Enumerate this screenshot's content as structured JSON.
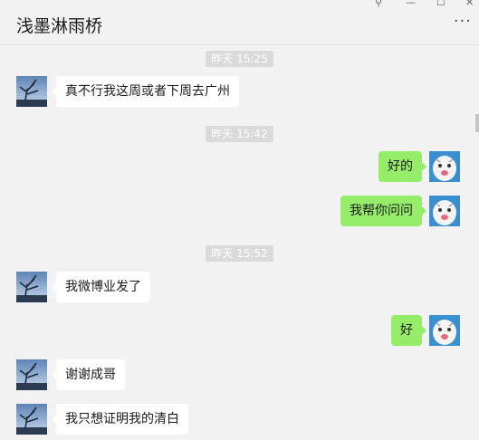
{
  "window": {
    "title": "浅墨淋雨桥",
    "controls": {
      "pin": "⚲",
      "minimize": "—",
      "maximize": "☐",
      "close": "✕"
    },
    "more_label": "···"
  },
  "colors": {
    "background": "#f2f2f2",
    "incoming_bubble": "#ffffff",
    "outgoing_bubble": "#95ec69",
    "timestamp_bg": "#dadada"
  },
  "timestamps": [
    "昨天 15:25",
    "昨天 15:42",
    "昨天 15:52"
  ],
  "messages": [
    {
      "side": "left",
      "avatar": "tree-avatar",
      "text": "真不行我这周或者下周去广州"
    },
    {
      "side": "right",
      "avatar": "white-tiger-avatar",
      "text": "好的"
    },
    {
      "side": "right",
      "avatar": "white-tiger-avatar",
      "text": "我帮你问问"
    },
    {
      "side": "left",
      "avatar": "tree-avatar",
      "text": "我微博业发了"
    },
    {
      "side": "right",
      "avatar": "white-tiger-avatar",
      "text": "好"
    },
    {
      "side": "left",
      "avatar": "tree-avatar",
      "text": "谢谢成哥"
    },
    {
      "side": "left",
      "avatar": "tree-avatar",
      "text": "我只想证明我的清白"
    }
  ]
}
